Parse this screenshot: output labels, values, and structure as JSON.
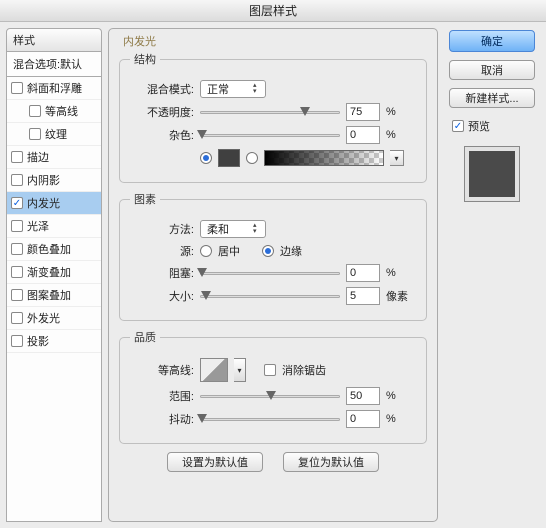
{
  "window_title": "图层样式",
  "styles": {
    "header": "样式",
    "default_label": "混合选项:默认",
    "items": [
      {
        "label": "斜面和浮雕",
        "checked": false,
        "sub": false,
        "active": false
      },
      {
        "label": "等高线",
        "checked": false,
        "sub": true,
        "active": false
      },
      {
        "label": "纹理",
        "checked": false,
        "sub": true,
        "active": false
      },
      {
        "label": "描边",
        "checked": false,
        "sub": false,
        "active": false
      },
      {
        "label": "内阴影",
        "checked": false,
        "sub": false,
        "active": false
      },
      {
        "label": "内发光",
        "checked": true,
        "sub": false,
        "active": true
      },
      {
        "label": "光泽",
        "checked": false,
        "sub": false,
        "active": false
      },
      {
        "label": "颜色叠加",
        "checked": false,
        "sub": false,
        "active": false
      },
      {
        "label": "渐变叠加",
        "checked": false,
        "sub": false,
        "active": false
      },
      {
        "label": "图案叠加",
        "checked": false,
        "sub": false,
        "active": false
      },
      {
        "label": "外发光",
        "checked": false,
        "sub": false,
        "active": false
      },
      {
        "label": "投影",
        "checked": false,
        "sub": false,
        "active": false
      }
    ]
  },
  "panel_title": "内发光",
  "structure": {
    "legend": "结构",
    "blend_mode_label": "混合模式:",
    "blend_mode_value": "正常",
    "opacity_label": "不透明度:",
    "opacity_value": "75",
    "opacity_unit": "%",
    "noise_label": "杂色:",
    "noise_value": "0",
    "noise_unit": "%",
    "color_swatch_hex": "#404040"
  },
  "elements": {
    "legend": "图素",
    "method_label": "方法:",
    "method_value": "柔和",
    "source_label": "源:",
    "source_center": "居中",
    "source_edge": "边缘",
    "choke_label": "阻塞:",
    "choke_value": "0",
    "choke_unit": "%",
    "size_label": "大小:",
    "size_value": "5",
    "size_unit": "像素"
  },
  "quality": {
    "legend": "品质",
    "contour_label": "等高线:",
    "antialias_label": "消除锯齿",
    "range_label": "范围:",
    "range_value": "50",
    "range_unit": "%",
    "jitter_label": "抖动:",
    "jitter_value": "0",
    "jitter_unit": "%"
  },
  "footer": {
    "make_default": "设置为默认值",
    "reset_default": "复位为默认值"
  },
  "right": {
    "ok": "确定",
    "cancel": "取消",
    "new_style": "新建样式...",
    "preview": "预览"
  }
}
